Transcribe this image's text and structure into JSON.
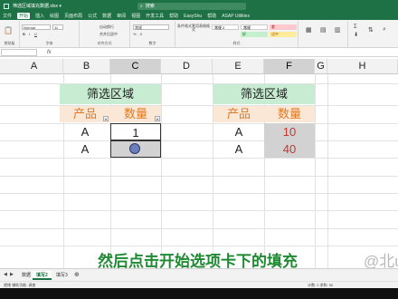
{
  "titlebar": {
    "filename": "筛选区域填充数据.xlsx  ▾",
    "search_placeholder": "搜索"
  },
  "menu": [
    "文件",
    "开始",
    "插入",
    "绘图",
    "页面布局",
    "公式",
    "数据",
    "审阅",
    "视图",
    "开发工具",
    "帮助",
    "EasyShu",
    "帮助",
    "ASAP Utilities"
  ],
  "menu_active_index": 1,
  "ribbon": {
    "font_name": "Normal",
    "font_size": "11",
    "wrap_text": "自动换行",
    "merge_center": "合并后居中",
    "number_format": "常规",
    "cond_format": "条件格式",
    "table_format": "套用表格格式",
    "style_normal": "常规 2",
    "style_normal2": "常规",
    "style_bad": "差",
    "style_good": "好",
    "style_neutral": "适中",
    "group_labels": [
      "剪贴板",
      "字体",
      "对齐方式",
      "数字",
      "样式"
    ]
  },
  "columns": [
    "A",
    "B",
    "C",
    "D",
    "E",
    "F",
    "G",
    "H"
  ],
  "selected_columns": [
    "C",
    "F"
  ],
  "table_left": {
    "title": "筛选区域",
    "header_product": "产品",
    "header_qty": "数量",
    "rows": [
      {
        "product": "A",
        "qty": "1"
      },
      {
        "product": "A",
        "qty": ""
      }
    ]
  },
  "table_right": {
    "title": "筛选区域",
    "header_product": "产品",
    "header_qty": "数量",
    "rows": [
      {
        "product": "A",
        "qty": "10"
      },
      {
        "product": "A",
        "qty": "40"
      }
    ]
  },
  "subtitle": "然后点击开始选项卡下的填充",
  "watermark": "@北u",
  "sheets": [
    "数据",
    "填写2",
    "填写3"
  ],
  "active_sheet_index": 1,
  "status": {
    "left": "就绪  辅助功能: 调查",
    "right": "计数: 2   求和: 50"
  },
  "colors": {
    "accent": "#1e7145",
    "subtitle": "#1f8a33",
    "header_green": "#c8ecd2",
    "header_orange": "#fbe7d5",
    "red_text": "#c0392b"
  }
}
